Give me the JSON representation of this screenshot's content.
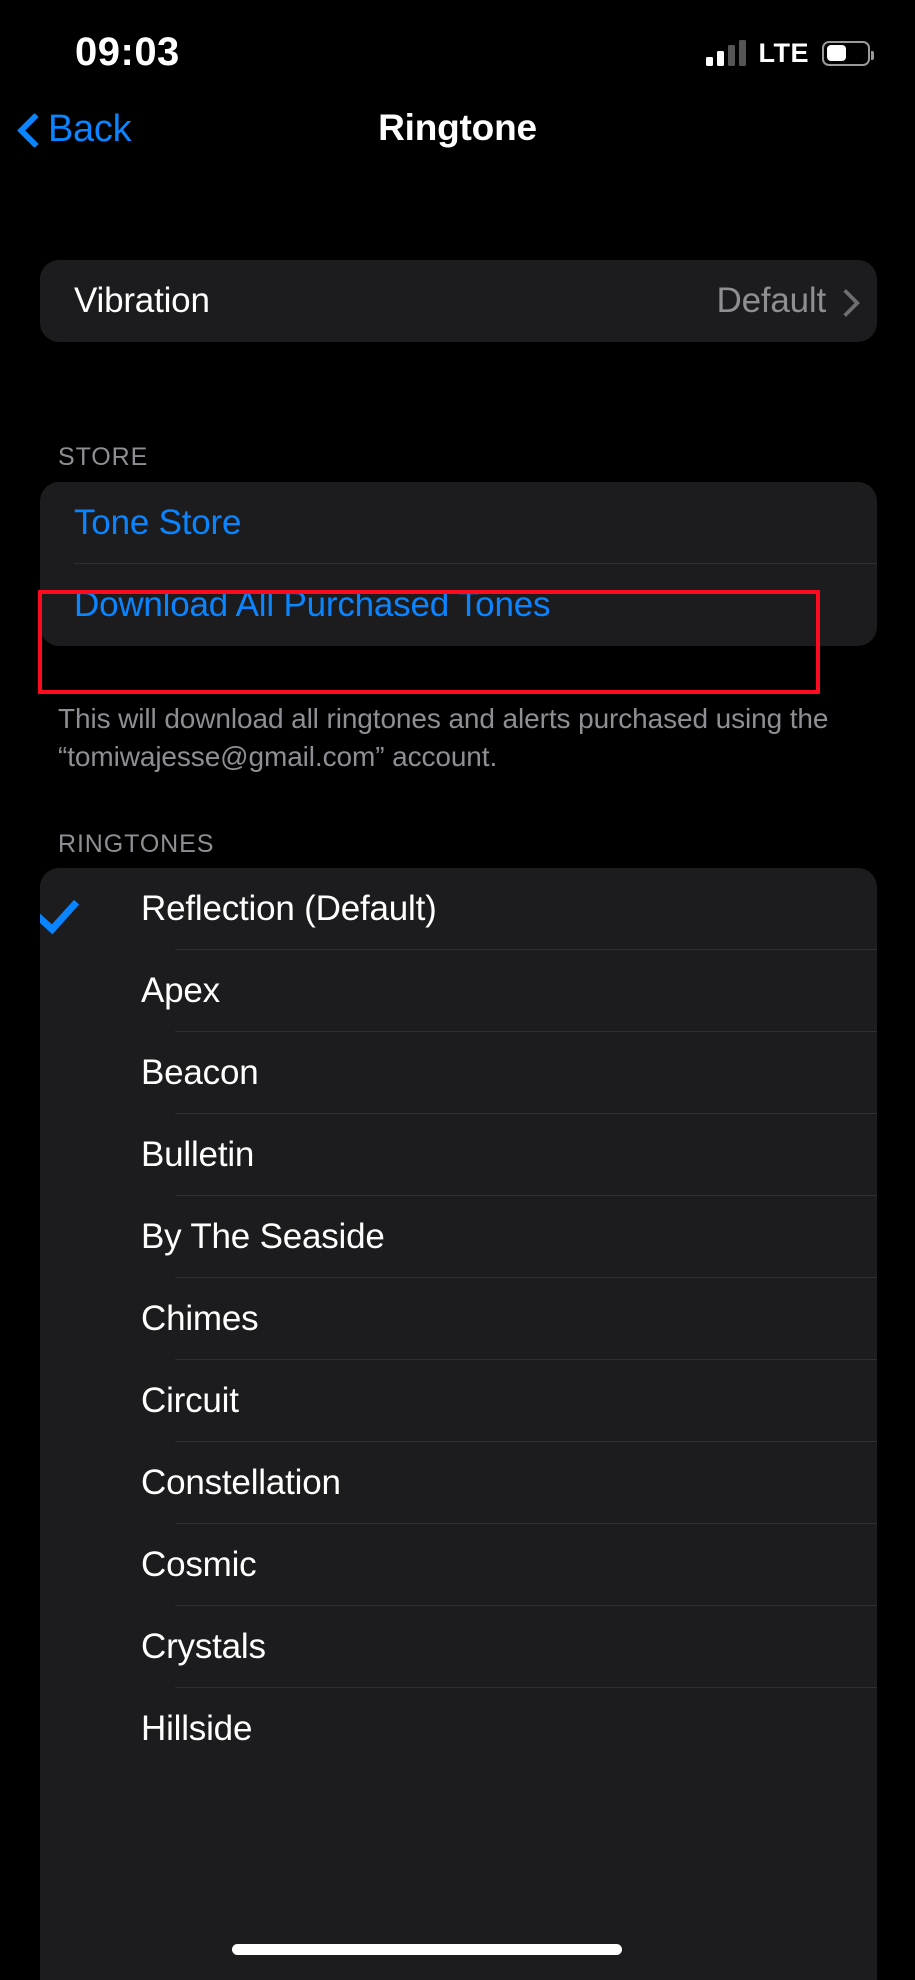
{
  "status_bar": {
    "time": "09:03",
    "network_label": "LTE",
    "signal_icon": "cellular-signal-icon",
    "battery_icon": "battery-icon"
  },
  "nav": {
    "back_label": "Back",
    "back_icon": "chevron-left-icon",
    "title": "Ringtone"
  },
  "vibration": {
    "label": "Vibration",
    "value": "Default",
    "chevron_icon": "chevron-right-icon"
  },
  "store": {
    "header": "STORE",
    "tone_store_label": "Tone Store",
    "download_all_label": "Download All Purchased Tones",
    "footer": "This will download all ringtones and alerts purchased using the “tomiwajesse@gmail.com” account."
  },
  "ringtones": {
    "header": "RINGTONES",
    "selected": "Reflection (Default)",
    "items": [
      {
        "label": "Reflection (Default)",
        "checked": true
      },
      {
        "label": "Apex",
        "checked": false
      },
      {
        "label": "Beacon",
        "checked": false
      },
      {
        "label": "Bulletin",
        "checked": false
      },
      {
        "label": "By The Seaside",
        "checked": false
      },
      {
        "label": "Chimes",
        "checked": false
      },
      {
        "label": "Circuit",
        "checked": false
      },
      {
        "label": "Constellation",
        "checked": false
      },
      {
        "label": "Cosmic",
        "checked": false
      },
      {
        "label": "Crystals",
        "checked": false
      },
      {
        "label": "Hillside",
        "checked": false
      }
    ]
  },
  "annotation": {
    "target": "Download All Purchased Tones",
    "color": "#FF0A1E"
  },
  "colors": {
    "background": "#000000",
    "card": "#1C1C1E",
    "accent_blue": "#0A84FF",
    "secondary_text": "#8E8E93",
    "separator": "#2F2F31"
  },
  "home_indicator": "home-indicator"
}
